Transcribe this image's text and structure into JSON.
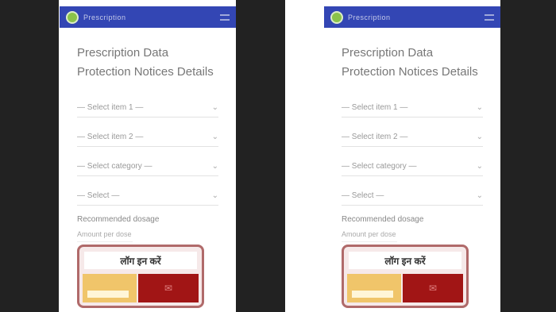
{
  "panels": [
    {
      "app_title": "Prescription",
      "page_title": "Prescription Data Protection Notices Details",
      "dropdowns": [
        "— Select item 1 —",
        "— Select item 2 —",
        "— Select category —",
        "— Select —"
      ],
      "section_label": "Recommended dosage",
      "section_value": "Amount per dose",
      "banner_title": "लॉग इन करें",
      "banner_icon": "✉"
    },
    {
      "app_title": "Prescription",
      "page_title": "Prescription Data Protection Notices Details",
      "dropdowns": [
        "— Select item 1 —",
        "— Select item 2 —",
        "— Select category —",
        "— Select —"
      ],
      "section_label": "Recommended dosage",
      "section_value": "Amount per dose",
      "banner_title": "लॉग इन करें",
      "banner_icon": "✉"
    }
  ],
  "colors": {
    "appbar": "#3346b4",
    "background_dark": "#222222",
    "banner_red": "#a11515",
    "banner_yellow": "#f0c56a"
  }
}
